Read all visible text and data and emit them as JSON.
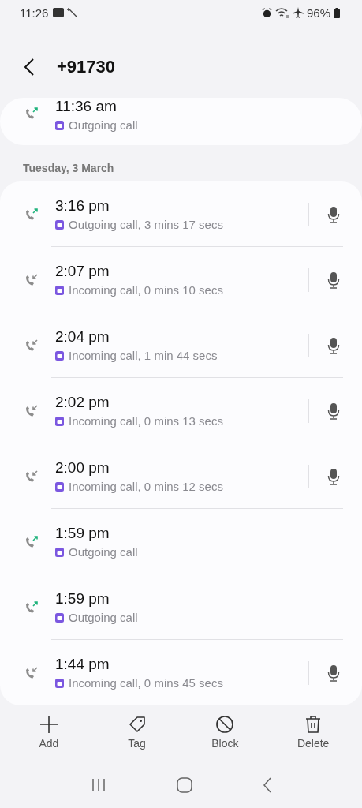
{
  "status_bar": {
    "time": "11:26",
    "battery": "96%"
  },
  "header": {
    "title": "+91730"
  },
  "earlier_calls": [
    {
      "time": "11:36 am",
      "kind": "outgoing",
      "detail": "Outgoing call",
      "recording": false
    }
  ],
  "date_header": "Tuesday, 3 March",
  "calls": [
    {
      "time": "3:16 pm",
      "kind": "outgoing",
      "detail": "Outgoing call, 3 mins 17 secs",
      "recording": true
    },
    {
      "time": "2:07 pm",
      "kind": "incoming",
      "detail": "Incoming call, 0 mins 10 secs",
      "recording": true
    },
    {
      "time": "2:04 pm",
      "kind": "incoming",
      "detail": "Incoming call, 1 min 44 secs",
      "recording": true
    },
    {
      "time": "2:02 pm",
      "kind": "incoming",
      "detail": "Incoming call, 0 mins 13 secs",
      "recording": true
    },
    {
      "time": "2:00 pm",
      "kind": "incoming",
      "detail": "Incoming call, 0 mins 12 secs",
      "recording": true
    },
    {
      "time": "1:59 pm",
      "kind": "outgoing",
      "detail": "Outgoing call",
      "recording": false
    },
    {
      "time": "1:59 pm",
      "kind": "outgoing",
      "detail": "Outgoing call",
      "recording": false
    },
    {
      "time": "1:44 pm",
      "kind": "incoming",
      "detail": "Incoming call, 0 mins 45 secs",
      "recording": true
    }
  ],
  "actions": [
    {
      "kind": "add",
      "label": "Add"
    },
    {
      "kind": "tag",
      "label": "Tag"
    },
    {
      "kind": "block",
      "label": "Block"
    },
    {
      "kind": "delete",
      "label": "Delete"
    }
  ]
}
